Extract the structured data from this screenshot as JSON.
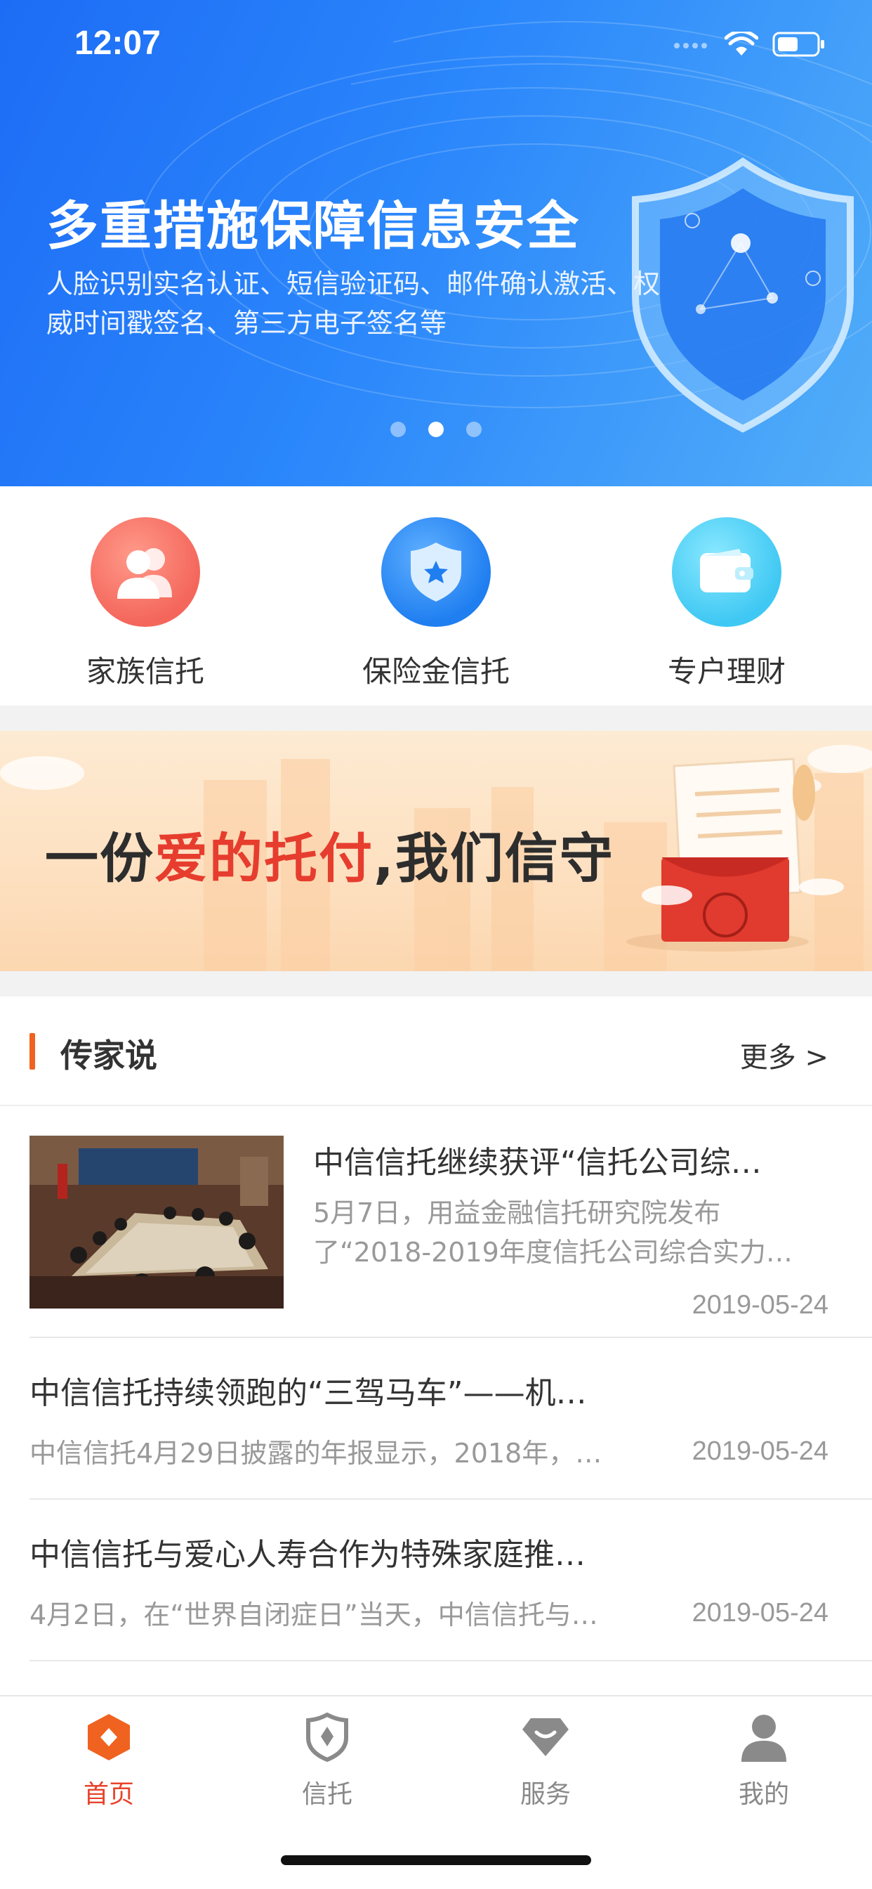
{
  "status_bar": {
    "time": "12:07"
  },
  "hero": {
    "title": "多重措施保障信息安全",
    "subtitle": "人脸识别实名认证、短信验证码、邮件确认激活、权威时间戳签名、第三方电子签名等",
    "carousel_total": 3,
    "carousel_active_index": 2
  },
  "quick_entries": [
    {
      "label": "家族信托",
      "icon": "family-users-icon",
      "color": "#f4665b"
    },
    {
      "label": "保险金信托",
      "icon": "shield-star-icon",
      "color": "#2b8af7"
    },
    {
      "label": "专户理财",
      "icon": "wallet-icon",
      "color": "#45d2f5"
    }
  ],
  "promo": {
    "text_before": "一份",
    "text_highlight": "爱的托付",
    "text_after": ",我们信守"
  },
  "section": {
    "title": "传家说",
    "more_label": "更多 >"
  },
  "news": [
    {
      "title": "中信信托继续获评“信托公司综…",
      "desc": "5月7日，用益金融信托研究院发布了“2018-2019年度信托公司综合实力…",
      "date": "2019-05-24",
      "has_image": true
    },
    {
      "title": "中信信托持续领跑的“三驾马车”——机…",
      "desc": "中信信托4月29日披露的年报显示，2018年，…",
      "date": "2019-05-24"
    },
    {
      "title": "中信信托与爱心人寿合作为特殊家庭推…",
      "desc": "4月2日，在“世界自闭症日”当天，中信信托与…",
      "date": "2019-05-24"
    }
  ],
  "tabs": [
    {
      "label": "首页",
      "icon": "home-diamond-icon",
      "active": true
    },
    {
      "label": "信托",
      "icon": "trust-shield-icon",
      "active": false
    },
    {
      "label": "服务",
      "icon": "service-gem-icon",
      "active": false
    },
    {
      "label": "我的",
      "icon": "profile-person-icon",
      "active": false
    }
  ],
  "colors": {
    "accent": "#e8432b",
    "hero_blue": "#2a86fb",
    "section_bar": "#f0621f"
  }
}
